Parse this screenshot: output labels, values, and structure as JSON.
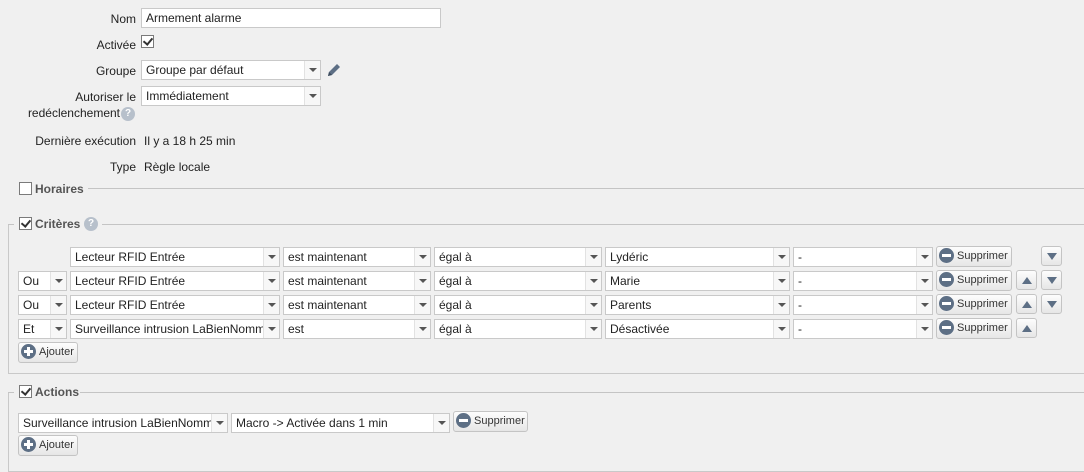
{
  "form": {
    "nom_label": "Nom",
    "nom_value": "Armement alarme",
    "activee_label": "Activée",
    "groupe_label": "Groupe",
    "groupe_value": "Groupe par défaut",
    "autoriser_label_line1": "Autoriser le",
    "autoriser_label_line2": "redéclenchement",
    "autoriser_value": "Immédiatement",
    "derniere_label": "Dernière exécution",
    "derniere_value": "Il y a 18 h 25 min",
    "type_label": "Type",
    "type_value": "Règle locale"
  },
  "sections": {
    "horaires": "Horaires",
    "criteres": "Critères",
    "actions": "Actions"
  },
  "criteria": [
    {
      "op": "",
      "device": "Lecteur RFID Entrée",
      "timing": "est maintenant",
      "cmp": "égal à",
      "value": "Lydéric",
      "extra": "-",
      "delete": "Supprimer"
    },
    {
      "op": "Ou",
      "device": "Lecteur RFID Entrée",
      "timing": "est maintenant",
      "cmp": "égal à",
      "value": "Marie",
      "extra": "-",
      "delete": "Supprimer"
    },
    {
      "op": "Ou",
      "device": "Lecteur RFID Entrée",
      "timing": "est maintenant",
      "cmp": "égal à",
      "value": "Parents",
      "extra": "-",
      "delete": "Supprimer"
    },
    {
      "op": "Et",
      "device": "Surveillance intrusion LaBienNommée",
      "timing": "est",
      "cmp": "égal à",
      "value": "Désactivée",
      "extra": "-",
      "delete": "Supprimer"
    }
  ],
  "criteria_add": "Ajouter",
  "actions": [
    {
      "device": "Surveillance intrusion LaBienNommée",
      "command": "Macro -> Activée dans 1 min",
      "delete": "Supprimer"
    }
  ],
  "actions_add": "Ajouter",
  "icons": {
    "edit": "pencil-icon",
    "help": "question-icon",
    "delete": "minus-circle-icon",
    "add": "plus-circle-icon",
    "move_up": "arrow-up-icon",
    "move_down": "arrow-down-icon"
  },
  "colors": {
    "accent": "#5d6f85",
    "help": "#b7c0cb",
    "background": "#f0f0f0"
  }
}
